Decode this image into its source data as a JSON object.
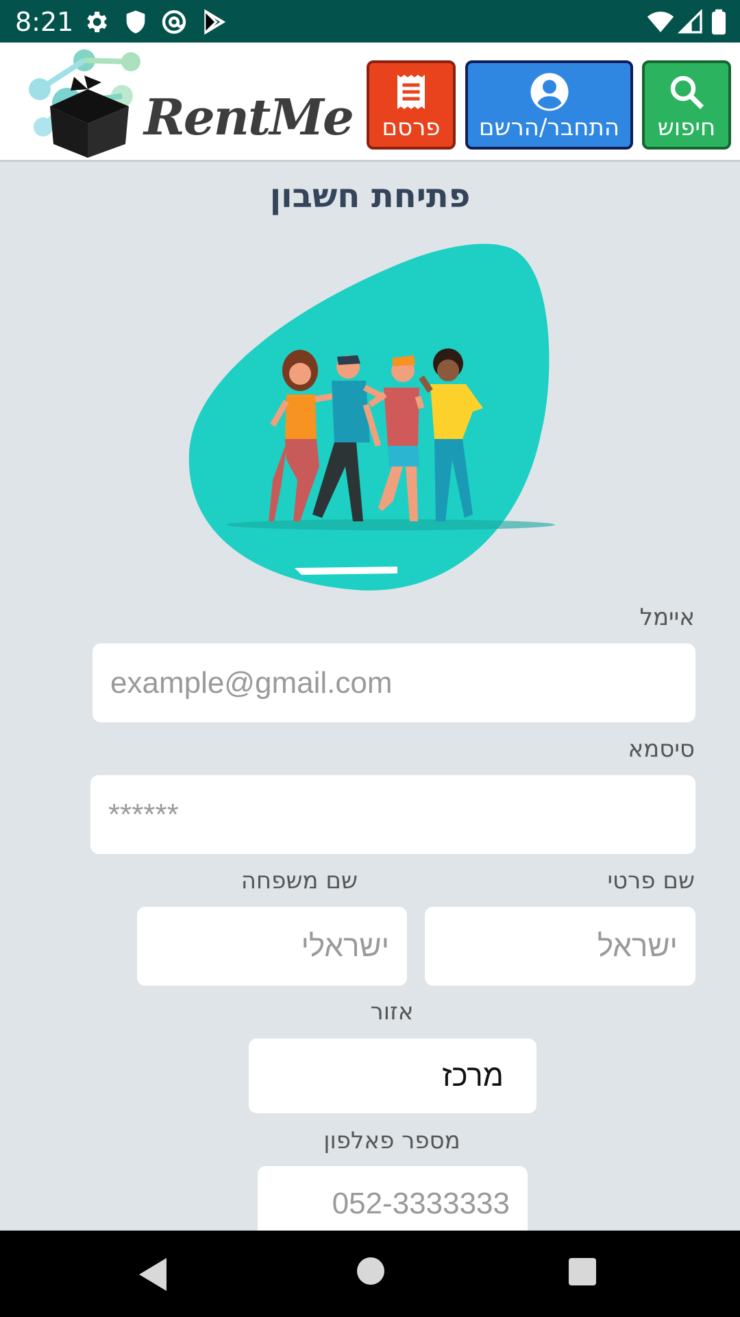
{
  "status": {
    "time": "8:21",
    "icons": [
      "gear-icon",
      "shield-icon",
      "at-circle-icon",
      "play-store-icon",
      "wifi-icon",
      "signal-icon",
      "battery-icon"
    ]
  },
  "header": {
    "logo_text": "RentMe",
    "publish_label": "פרסם",
    "login_label": "התחבר/הרשם",
    "search_label": "חיפוש",
    "colors": {
      "publish": "#e8431c",
      "login": "#2f87e2",
      "search": "#2cb360"
    }
  },
  "form": {
    "title": "פתיחת חשבון",
    "email_label": "איימל",
    "email_placeholder": "example@gmail.com",
    "password_label": "סיסמא",
    "password_placeholder": "******",
    "first_name_label": "שם פרטי",
    "first_name_placeholder": "ישראל",
    "last_name_label": "שם משפחה",
    "last_name_placeholder": "ישראלי",
    "region_label": "אזור",
    "region_value": "מרכז",
    "phone_label": "מספר פאלפון",
    "phone_placeholder": "052-3333333"
  },
  "colors": {
    "illustration_blob": "#1ecfc4",
    "background": "#dfe4e8",
    "title": "#34445a"
  }
}
